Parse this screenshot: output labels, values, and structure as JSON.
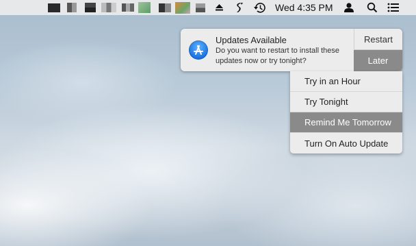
{
  "menubar": {
    "clock": "Wed 4:35 PM",
    "icons": [
      "eject-icon",
      "script-icon",
      "time-machine-icon",
      "user-icon",
      "spotlight-search-icon",
      "notification-center-icon"
    ]
  },
  "notification": {
    "title": "Updates Available",
    "body": "Do you want to restart to install these updates now or try tonight?",
    "restart_label": "Restart",
    "later_label": "Later"
  },
  "later_menu": {
    "items": [
      "Try in an Hour",
      "Try Tonight",
      "Remind Me Tomorrow",
      "Turn On Auto Update"
    ],
    "selected": "Remind Me Tomorrow"
  },
  "colors": {
    "menubar_bg": "#ececec",
    "highlight": "#8a8a8a",
    "app_store_blue": "#1a6fde"
  }
}
